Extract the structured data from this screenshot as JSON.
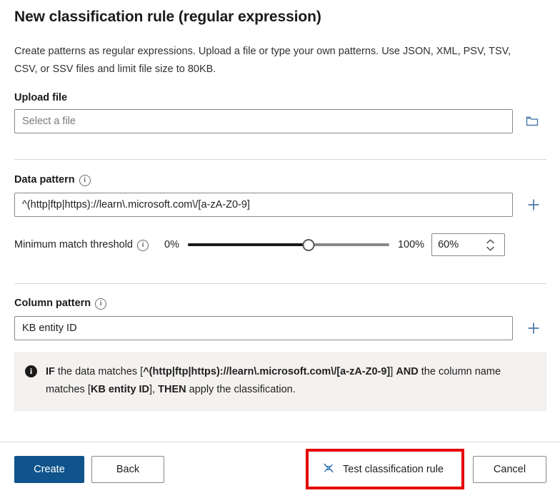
{
  "dialog": {
    "title": "New classification rule (regular expression)",
    "description": "Create patterns as regular expressions. Upload a file or type your own patterns. Use JSON, XML, PSV, TSV, CSV, or SSV files and limit file size to 80KB."
  },
  "upload": {
    "label": "Upload file",
    "placeholder": "Select a file",
    "value": "",
    "browse_icon": "folder-icon"
  },
  "data_pattern": {
    "label": "Data pattern",
    "info_icon": "info-icon",
    "value": "^(http|ftp|https)://learn\\.microsoft.com\\/[a-zA-Z0-9]",
    "add_icon": "plus-icon"
  },
  "threshold": {
    "label": "Minimum match threshold",
    "info_icon": "info-icon",
    "min_label": "0%",
    "max_label": "100%",
    "value": 60,
    "value_label": "60%",
    "increment_icon": "chevron-up-icon",
    "decrement_icon": "chevron-down-icon"
  },
  "column_pattern": {
    "label": "Column pattern",
    "info_icon": "info-icon",
    "value": "KB entity ID",
    "add_icon": "plus-icon"
  },
  "summary": {
    "icon": "info-filled-icon",
    "prefix": "IF the data matches [",
    "data_pattern": "^(http|ftp|https)://learn\\.microsoft.com\\/[a-zA-Z0-9]",
    "middle": "]] AND the column name matches [",
    "column_pattern": "KB entity ID",
    "suffix": "], THEN apply the classification.",
    "parts": {
      "if_word": "IF",
      "text1": " the data matches [",
      "text2": "] ",
      "and_word": "AND",
      "text3": " the column name matches [",
      "text4": "], ",
      "then_word": "THEN",
      "text5": " apply the classification."
    }
  },
  "footer": {
    "create_label": "Create",
    "back_label": "Back",
    "test_label": "Test classification rule",
    "test_icon": "dna-test-icon",
    "cancel_label": "Cancel"
  },
  "colors": {
    "primary": "#0f548c",
    "accent_icon": "#4a77a8",
    "highlight": "#e60000",
    "info_bg": "#f3f2f1"
  }
}
